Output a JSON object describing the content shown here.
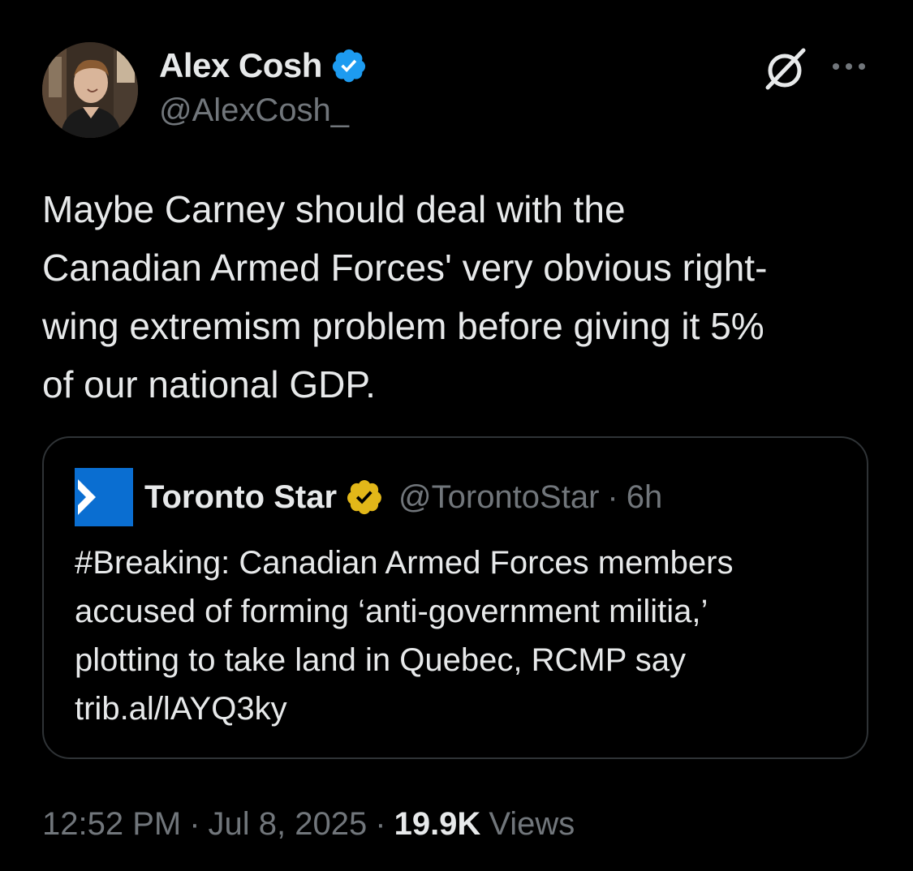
{
  "author": {
    "display_name": "Alex Cosh",
    "handle": "@AlexCosh_",
    "verified_color": "#1d9bf0"
  },
  "tweet": {
    "lines": [
      "Maybe Carney should deal with the",
      "Canadian Armed Forces' very obvious right-",
      "wing extremism problem before giving it 5%",
      "of our national GDP."
    ]
  },
  "quote": {
    "display_name": "Toronto Star",
    "handle": "@TorontoStar",
    "separator": "·",
    "time": "6h",
    "verified_color": "#e2b719",
    "logo_color": "#0a6ed1",
    "lines": [
      "#Breaking: Canadian Armed Forces members",
      "accused of forming ‘anti-government militia,’",
      "plotting to take land in Quebec, RCMP say",
      "trib.al/lAYQ3ky"
    ]
  },
  "meta": {
    "time": "12:52 PM",
    "separator": "·",
    "date": "Jul 8, 2025",
    "views_count": "19.9K",
    "views_label": "Views"
  },
  "icons": {
    "avatar": "avatar",
    "verified": "verified-badge-icon",
    "grok": "grok-icon",
    "more": "more-options-icon",
    "publisher_logo": "toronto-star-logo"
  }
}
